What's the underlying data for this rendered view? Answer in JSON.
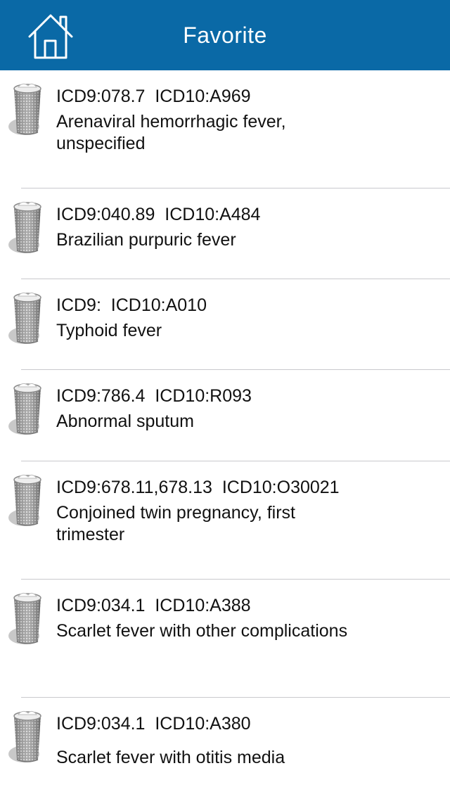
{
  "header": {
    "title": "Favorite",
    "home_icon": "home-icon"
  },
  "colors": {
    "navbar": "#0a69a6",
    "divider": "#c9c9cd"
  },
  "favorites": [
    {
      "codes": "ICD9:078.7  ICD10:A969",
      "description": "Arenaviral hemorrhagic fever, unspecified"
    },
    {
      "codes": "ICD9:040.89  ICD10:A484",
      "description": "Brazilian purpuric fever"
    },
    {
      "codes": "ICD9:  ICD10:A010",
      "description": "Typhoid fever"
    },
    {
      "codes": "ICD9:786.4  ICD10:R093",
      "description": "Abnormal sputum"
    },
    {
      "codes": "ICD9:678.11,678.13  ICD10:O30021",
      "description": "Conjoined twin pregnancy, first trimester"
    },
    {
      "codes": "ICD9:034.1  ICD10:A388",
      "description": "Scarlet fever with other complications"
    },
    {
      "codes": "ICD9:034.1  ICD10:A380",
      "description": "Scarlet fever with otitis media"
    }
  ]
}
